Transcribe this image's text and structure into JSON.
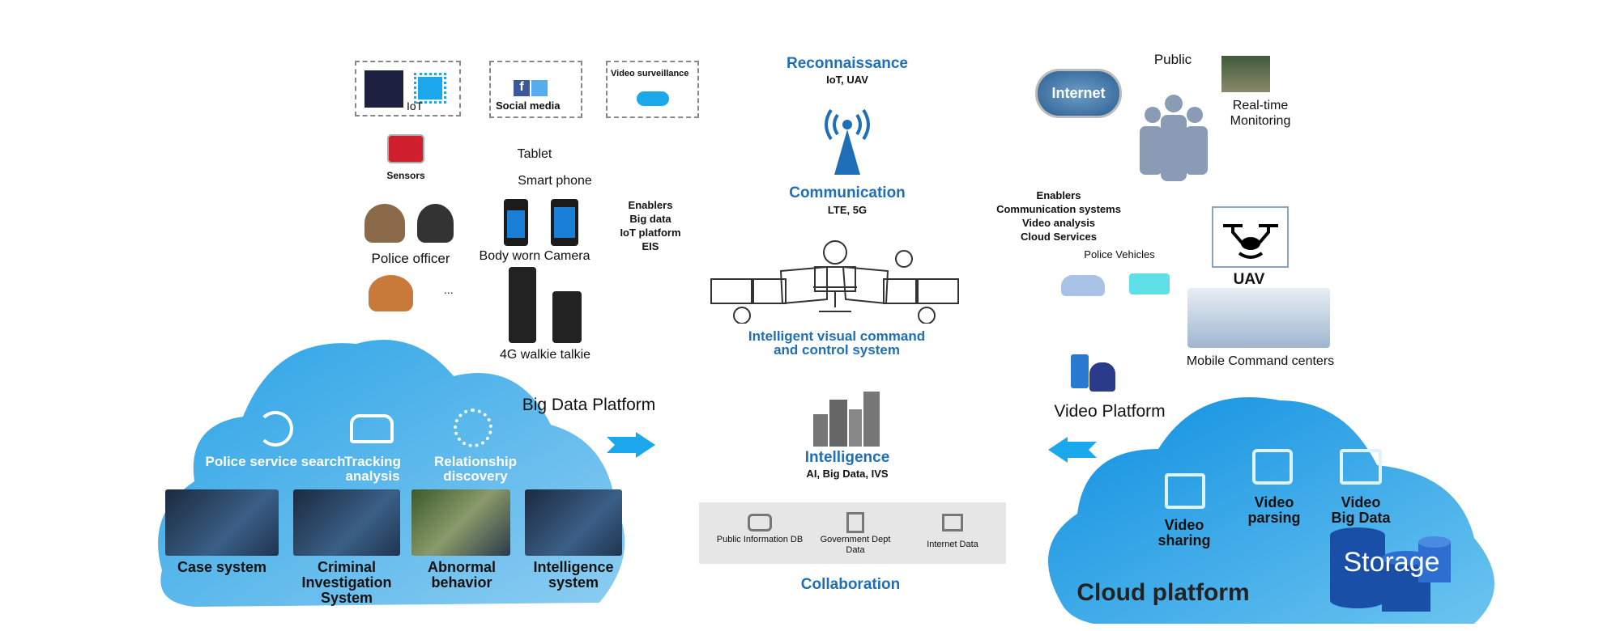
{
  "sources": {
    "iot": "IoT",
    "social_media": "Social media",
    "video_surveillance": "Video surveillance",
    "sensors": "Sensors",
    "tablet": "Tablet",
    "smart_phone": "Smart phone",
    "body_worn_camera": "Body worn Camera",
    "police_officer": "Police officer",
    "ellipsis": "...",
    "walkie_talkie": "4G walkie talkie"
  },
  "enablers_left": [
    "Enablers",
    "Big data",
    "IoT platform",
    "EIS"
  ],
  "center": {
    "reconnaissance": "Reconnaissance",
    "reconnaissance_sub": "IoT, UAV",
    "communication": "Communication",
    "communication_sub": "LTE, 5G",
    "command_line1": "Intelligent visual command",
    "command_line2": "and control system",
    "intelligence": "Intelligence",
    "intelligence_sub": "AI, Big Data, IVS",
    "collaboration": "Collaboration",
    "data_sources": [
      "Public Information DB",
      "Government Dept Data",
      "Internet Data"
    ]
  },
  "big_data": {
    "title": "Big Data Platform",
    "functions": [
      "Police service search",
      "Tracking analysis",
      "Relationship discovery"
    ],
    "systems": [
      "Case system",
      "Criminal Investigation System",
      "Abnormal behavior",
      "Intelligence system"
    ]
  },
  "right": {
    "internet": "Internet",
    "public": "Public",
    "realtime_line1": "Real-time",
    "realtime_line2": "Monitoring",
    "enablers": [
      "Enablers",
      "Communication  systems",
      "Video analysis",
      "Cloud Services"
    ],
    "police_vehicles": "Police Vehicles",
    "uav": "UAV",
    "mobile_command": "Mobile Command centers",
    "video_platform": "Video Platform"
  },
  "cloud": {
    "items": [
      "Video sharing",
      "Video parsing",
      "Video Big Data"
    ],
    "storage": "Storage",
    "title": "Cloud platform"
  },
  "colors": {
    "accent": "#1f6fb8",
    "cloud_blue": "#1a9be0",
    "arrow": "#1aa7ec"
  }
}
